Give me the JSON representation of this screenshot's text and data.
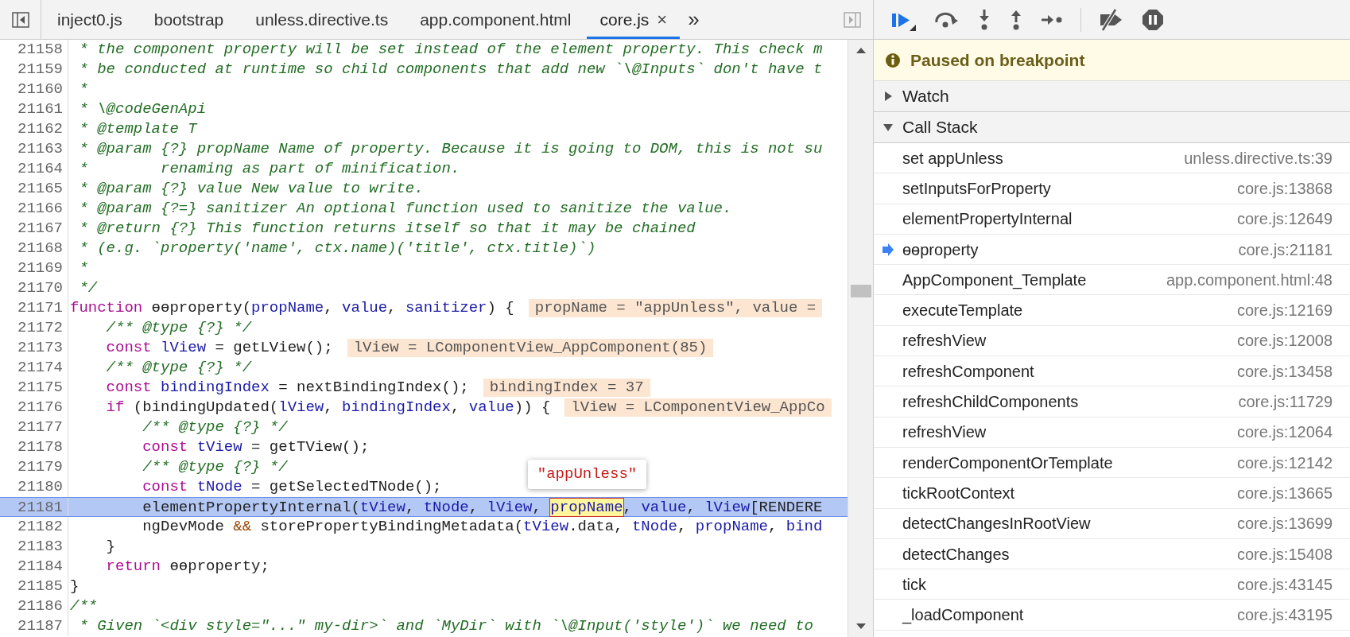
{
  "tabs": [
    {
      "label": "inject0.js",
      "selected": false
    },
    {
      "label": "bootstrap",
      "selected": false
    },
    {
      "label": "unless.directive.ts",
      "selected": false
    },
    {
      "label": "app.component.html",
      "selected": false
    },
    {
      "label": "core.js",
      "selected": true,
      "close": "×"
    }
  ],
  "more_tabs": "»",
  "code": [
    {
      "number": "21158",
      "current": false,
      "tokens": [
        {
          "kind": "comment",
          "text": " * the component property will be set instead of the element property. This check m"
        }
      ]
    },
    {
      "number": "21159",
      "current": false,
      "tokens": [
        {
          "kind": "comment",
          "text": " * be conducted at runtime so child components that add new `\\@Inputs` don't have t"
        }
      ]
    },
    {
      "number": "21160",
      "current": false,
      "tokens": [
        {
          "kind": "comment",
          "text": " *"
        }
      ]
    },
    {
      "number": "21161",
      "current": false,
      "tokens": [
        {
          "kind": "comment",
          "text": " * \\@codeGenApi"
        }
      ]
    },
    {
      "number": "21162",
      "current": false,
      "tokens": [
        {
          "kind": "comment",
          "text": " * @template T"
        }
      ]
    },
    {
      "number": "21163",
      "current": false,
      "tokens": [
        {
          "kind": "comment",
          "text": " * @param {?} propName Name of property. Because it is going to DOM, this is not su"
        }
      ]
    },
    {
      "number": "21164",
      "current": false,
      "tokens": [
        {
          "kind": "comment",
          "text": " *        renaming as part of minification."
        }
      ]
    },
    {
      "number": "21165",
      "current": false,
      "tokens": [
        {
          "kind": "comment",
          "text": " * @param {?} value New value to write."
        }
      ]
    },
    {
      "number": "21166",
      "current": false,
      "tokens": [
        {
          "kind": "comment",
          "text": " * @param {?=} sanitizer An optional function used to sanitize the value."
        }
      ]
    },
    {
      "number": "21167",
      "current": false,
      "tokens": [
        {
          "kind": "comment",
          "text": " * @return {?} This function returns itself so that it may be chained"
        }
      ]
    },
    {
      "number": "21168",
      "current": false,
      "tokens": [
        {
          "kind": "comment",
          "text": " * (e.g. `property('name', ctx.name)('title', ctx.title)`)"
        }
      ]
    },
    {
      "number": "21169",
      "current": false,
      "tokens": [
        {
          "kind": "comment",
          "text": " *"
        }
      ]
    },
    {
      "number": "21170",
      "current": false,
      "tokens": [
        {
          "kind": "comment",
          "text": " */"
        }
      ]
    },
    {
      "number": "21171",
      "current": false,
      "inline_value": "propName = \"appUnless\", value =",
      "tokens": [
        {
          "kind": "keyword",
          "text": "function"
        },
        {
          "kind": "plain",
          "text": " ɵɵproperty("
        },
        {
          "kind": "variable",
          "text": "propName"
        },
        {
          "kind": "plain",
          "text": ", "
        },
        {
          "kind": "variable",
          "text": "value"
        },
        {
          "kind": "plain",
          "text": ", "
        },
        {
          "kind": "variable",
          "text": "sanitizer"
        },
        {
          "kind": "plain",
          "text": ") {"
        }
      ]
    },
    {
      "number": "21172",
      "current": false,
      "tokens": [
        {
          "kind": "comment",
          "text": "    /** @type {?} */"
        }
      ]
    },
    {
      "number": "21173",
      "current": false,
      "inline_value": "lView = LComponentView_AppComponent(85)",
      "tokens": [
        {
          "kind": "keyword",
          "text": "    const"
        },
        {
          "kind": "variable",
          "text": " lView"
        },
        {
          "kind": "plain",
          "text": " = getLView();"
        }
      ]
    },
    {
      "number": "21174",
      "current": false,
      "tokens": [
        {
          "kind": "comment",
          "text": "    /** @type {?} */"
        }
      ]
    },
    {
      "number": "21175",
      "current": false,
      "inline_value": "bindingIndex = 37",
      "tokens": [
        {
          "kind": "keyword",
          "text": "    const"
        },
        {
          "kind": "variable",
          "text": " bindingIndex"
        },
        {
          "kind": "plain",
          "text": " = nextBindingIndex();"
        }
      ]
    },
    {
      "number": "21176",
      "current": false,
      "inline_value": "lView = LComponentView_AppCo",
      "tokens": [
        {
          "kind": "keyword",
          "text": "    if"
        },
        {
          "kind": "plain",
          "text": " (bindingUpdated("
        },
        {
          "kind": "variable",
          "text": "lView"
        },
        {
          "kind": "plain",
          "text": ", "
        },
        {
          "kind": "variable",
          "text": "bindingIndex"
        },
        {
          "kind": "plain",
          "text": ", "
        },
        {
          "kind": "variable",
          "text": "value"
        },
        {
          "kind": "plain",
          "text": ")) {"
        }
      ]
    },
    {
      "number": "21177",
      "current": false,
      "tokens": [
        {
          "kind": "comment",
          "text": "        /** @type {?} */"
        }
      ]
    },
    {
      "number": "21178",
      "current": false,
      "tokens": [
        {
          "kind": "keyword",
          "text": "        const"
        },
        {
          "kind": "variable",
          "text": " tView"
        },
        {
          "kind": "plain",
          "text": " = getTView();"
        }
      ]
    },
    {
      "number": "21179",
      "current": false,
      "tokens": [
        {
          "kind": "comment",
          "text": "        /** @type {?} */"
        }
      ]
    },
    {
      "number": "21180",
      "current": false,
      "tokens": [
        {
          "kind": "keyword",
          "text": "        const"
        },
        {
          "kind": "variable",
          "text": " tNode"
        },
        {
          "kind": "plain",
          "text": " = getSelectedTNode();"
        }
      ]
    },
    {
      "number": "21181",
      "current": true,
      "tokens": [
        {
          "kind": "plain",
          "text": "        elementPropertyInternal("
        },
        {
          "kind": "variable",
          "text": "tView"
        },
        {
          "kind": "plain",
          "text": ", "
        },
        {
          "kind": "variable",
          "text": "tNode"
        },
        {
          "kind": "plain",
          "text": ", "
        },
        {
          "kind": "variable",
          "text": "lView"
        },
        {
          "kind": "plain",
          "text": ", "
        },
        {
          "kind": "variable",
          "text": "propName",
          "tooltip": "\"appUnless\""
        },
        {
          "kind": "plain",
          "text": ", "
        },
        {
          "kind": "variable",
          "text": "value"
        },
        {
          "kind": "plain",
          "text": ", "
        },
        {
          "kind": "variable",
          "text": "lView"
        },
        {
          "kind": "plain",
          "text": "[RENDERE"
        }
      ]
    },
    {
      "number": "21182",
      "current": false,
      "tokens": [
        {
          "kind": "plain",
          "text": "        ngDevMode "
        },
        {
          "kind": "operator",
          "text": "&&"
        },
        {
          "kind": "plain",
          "text": " storePropertyBindingMetadata("
        },
        {
          "kind": "variable",
          "text": "tView"
        },
        {
          "kind": "plain",
          "text": ".data, "
        },
        {
          "kind": "variable",
          "text": "tNode"
        },
        {
          "kind": "plain",
          "text": ", "
        },
        {
          "kind": "variable",
          "text": "propName"
        },
        {
          "kind": "plain",
          "text": ", "
        },
        {
          "kind": "variable",
          "text": "bind"
        }
      ]
    },
    {
      "number": "21183",
      "current": false,
      "tokens": [
        {
          "kind": "plain",
          "text": "    }"
        }
      ]
    },
    {
      "number": "21184",
      "current": false,
      "tokens": [
        {
          "kind": "keyword",
          "text": "    return"
        },
        {
          "kind": "plain",
          "text": " ɵɵproperty;"
        }
      ]
    },
    {
      "number": "21185",
      "current": false,
      "tokens": [
        {
          "kind": "plain",
          "text": "}"
        }
      ]
    },
    {
      "number": "21186",
      "current": false,
      "tokens": [
        {
          "kind": "comment",
          "text": "/**"
        }
      ]
    },
    {
      "number": "21187",
      "current": false,
      "tokens": [
        {
          "kind": "comment",
          "text": " * Given `<div style=\"...\" my-dir>` and `MyDir` with `\\@Input('style')` we need to"
        }
      ]
    }
  ],
  "banner": "Paused on breakpoint",
  "sections": [
    {
      "title": "Watch",
      "expanded": false
    },
    {
      "title": "Call Stack",
      "expanded": true
    }
  ],
  "call_stack": [
    {
      "function": "set appUnless",
      "location": "unless.directive.ts:39",
      "current": false
    },
    {
      "function": "setInputsForProperty",
      "location": "core.js:13868",
      "current": false
    },
    {
      "function": "elementPropertyInternal",
      "location": "core.js:12649",
      "current": false
    },
    {
      "function": "ɵɵproperty",
      "location": "core.js:21181",
      "current": true
    },
    {
      "function": "AppComponent_Template",
      "location": "app.component.html:48",
      "current": false
    },
    {
      "function": "executeTemplate",
      "location": "core.js:12169",
      "current": false
    },
    {
      "function": "refreshView",
      "location": "core.js:12008",
      "current": false
    },
    {
      "function": "refreshComponent",
      "location": "core.js:13458",
      "current": false
    },
    {
      "function": "refreshChildComponents",
      "location": "core.js:11729",
      "current": false
    },
    {
      "function": "refreshView",
      "location": "core.js:12064",
      "current": false
    },
    {
      "function": "renderComponentOrTemplate",
      "location": "core.js:12142",
      "current": false
    },
    {
      "function": "tickRootContext",
      "location": "core.js:13665",
      "current": false
    },
    {
      "function": "detectChangesInRootView",
      "location": "core.js:13699",
      "current": false
    },
    {
      "function": "detectChanges",
      "location": "core.js:15408",
      "current": false
    },
    {
      "function": "tick",
      "location": "core.js:43145",
      "current": false
    },
    {
      "function": "_loadComponent",
      "location": "core.js:43195",
      "current": false
    }
  ]
}
